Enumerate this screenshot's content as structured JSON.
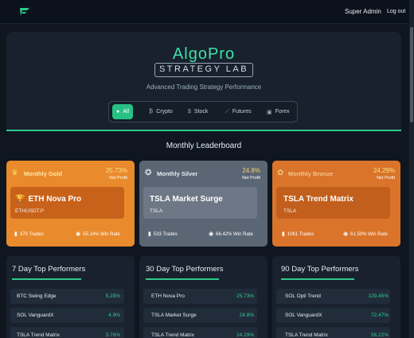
{
  "header": {
    "user_name": "Super Admin",
    "logout_label": "Log out"
  },
  "hero": {
    "brand_top": "AlgoPro",
    "brand_bottom": "STRATEGY LAB",
    "subtitle": "Advanced Trading Strategy Performance"
  },
  "filters": [
    {
      "label": "All",
      "icon": "grid-icon",
      "active": true
    },
    {
      "label": "Crypto",
      "icon": "bitcoin-icon",
      "active": false
    },
    {
      "label": "Stock",
      "icon": "dollar-icon",
      "active": false
    },
    {
      "label": "Futures",
      "icon": "chart-line-icon",
      "active": false
    },
    {
      "label": "Forex",
      "icon": "exchange-icon",
      "active": false
    }
  ],
  "leaderboard": {
    "title": "Monthly Leaderboard",
    "cards": [
      {
        "tier": "Monthly Gold",
        "icon": "crown-icon",
        "pct": "25.73%",
        "pct_label": "Net Profit",
        "name": "ETH Nova Pro",
        "symbol": "ETHUSDT.P",
        "trades": "370 Trades",
        "win_rate": "55.14% Win Rate"
      },
      {
        "tier": "Monthly Silver",
        "icon": "medal-icon",
        "pct": "24.8%",
        "pct_label": "Net Profit",
        "name": "TSLA Market Surge",
        "symbol": "TSLA",
        "trades": "533 Trades",
        "win_rate": "66.42% Win Rate"
      },
      {
        "tier": "Monthly Bronze",
        "icon": "award-icon",
        "pct": "24.29%",
        "pct_label": "Net Profit",
        "name": "TSLA Trend Matrix",
        "symbol": "TSLA",
        "trades": "1061 Trades",
        "win_rate": "61.50% Win Rate"
      }
    ]
  },
  "performers": [
    {
      "title": "7 Day Top Performers",
      "rows": [
        {
          "name": "BTC Swing Edge",
          "value": "5.29%"
        },
        {
          "name": "SOL VanguardX",
          "value": "4.9%"
        },
        {
          "name": "TSLA Trend Matrix",
          "value": "3.76%"
        }
      ]
    },
    {
      "title": "30 Day Top Performers",
      "rows": [
        {
          "name": "ETH Nova Pro",
          "value": "25.73%"
        },
        {
          "name": "TSLA Market Surge",
          "value": "24.8%"
        },
        {
          "name": "TSLA Trend Matrix",
          "value": "24.29%"
        }
      ]
    },
    {
      "title": "90 Day Top Performers",
      "rows": [
        {
          "name": "SOL Opti Trend",
          "value": "129.45%"
        },
        {
          "name": "SOL VanguardX",
          "value": "72.47%"
        },
        {
          "name": "TSLA Trend Matrix",
          "value": "56.22%"
        }
      ]
    }
  ],
  "colors": {
    "accent": "#27c184",
    "gold": "#e98a2c",
    "silver": "#5b6674",
    "bronze": "#d9742a",
    "positive": "#2fd08f"
  }
}
